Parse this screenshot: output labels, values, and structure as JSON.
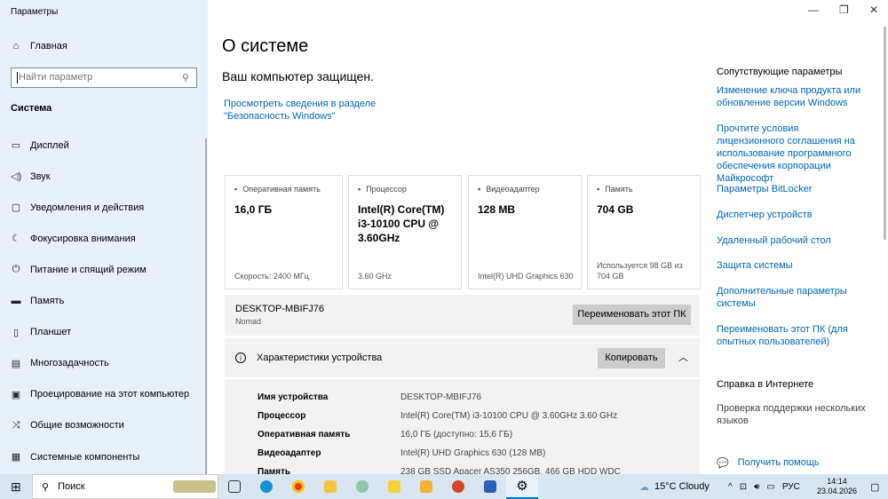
{
  "window": {
    "title": "Параметры",
    "minimize": "—",
    "maximize": "❐",
    "close": "✕"
  },
  "sidebar": {
    "home": "Главная",
    "search_placeholder": "Найти параметр",
    "section": "Система",
    "items": [
      {
        "label": "Дисплей",
        "icon": "display-icon"
      },
      {
        "label": "Звук",
        "icon": "sound-icon"
      },
      {
        "label": "Уведомления и действия",
        "icon": "notifications-icon"
      },
      {
        "label": "Фокусировка внимания",
        "icon": "focus-icon"
      },
      {
        "label": "Питание и спящий режим",
        "icon": "power-icon"
      },
      {
        "label": "Память",
        "icon": "storage-icon"
      },
      {
        "label": "Планшет",
        "icon": "tablet-icon"
      },
      {
        "label": "Многозадачность",
        "icon": "multitasking-icon"
      },
      {
        "label": "Проецирование на этот компьютер",
        "icon": "projecting-icon"
      },
      {
        "label": "Общие возможности",
        "icon": "shared-icon"
      },
      {
        "label": "Системные компоненты",
        "icon": "components-icon"
      }
    ]
  },
  "main": {
    "title": "О системе",
    "protected": "Ваш компьютер защищен.",
    "security_link": "Просмотреть сведения в разделе \"Безопасность Windows\"",
    "cards": [
      {
        "label": "Оперативная память",
        "value": "16,0 ГБ",
        "sub": "Скорость: 2400 МГц"
      },
      {
        "label": "Процессор",
        "value": "Intel(R) Core(TM) i3-10100 CPU @ 3.60GHz",
        "sub": "3.60 GHz"
      },
      {
        "label": "Видеоадаптер",
        "value": "128 MB",
        "sub": "Intel(R) UHD Graphics 630"
      },
      {
        "label": "Память",
        "value": "704 GB",
        "sub": "Используется 98 GB из 704 GB"
      }
    ],
    "device_name": "DESKTOP-MBIFJ76",
    "device_sub": "Nomad",
    "rename": "Переименовать этот ПК",
    "specs_title": "Характеристики устройства",
    "copy": "Копировать",
    "specs": [
      {
        "k": "Имя устройства",
        "v": "DESKTOP-MBIFJ76"
      },
      {
        "k": "Процессор",
        "v": "Intel(R) Core(TM) i3-10100 CPU @ 3.60GHz   3.60 GHz"
      },
      {
        "k": "Оперативная память",
        "v": "16,0 ГБ (доступно: 15,6 ГБ)"
      },
      {
        "k": "Видеоадаптер",
        "v": "Intel(R) UHD Graphics 630 (128 MB)"
      },
      {
        "k": "Память",
        "v": "238 GB SSD Apacer AS350 256GB, 466 GB HDD WDC"
      }
    ]
  },
  "related": {
    "title": "Сопутствующие параметры",
    "links": [
      "Изменение ключа продукта или обновление версии Windows",
      "Прочтите условия лицензионного соглашения на использование программного обеспечения корпорации Майкрософт",
      "Параметры BitLocker",
      "Диспетчер устройств",
      "Удаленный рабочий стол",
      "Защита системы",
      "Дополнительные параметры системы",
      "Переименовать этот ПК (для опытных пользователей)"
    ],
    "help_title": "Справка в Интернете",
    "help_links": [
      "Проверка поддержки нескольких языков"
    ],
    "get_help": "Получить помощь"
  },
  "taskbar": {
    "search": "Поиск",
    "weather": "15°C  Cloudy",
    "lang": "РУС",
    "time": "14:14",
    "date": "23.04.2026"
  }
}
